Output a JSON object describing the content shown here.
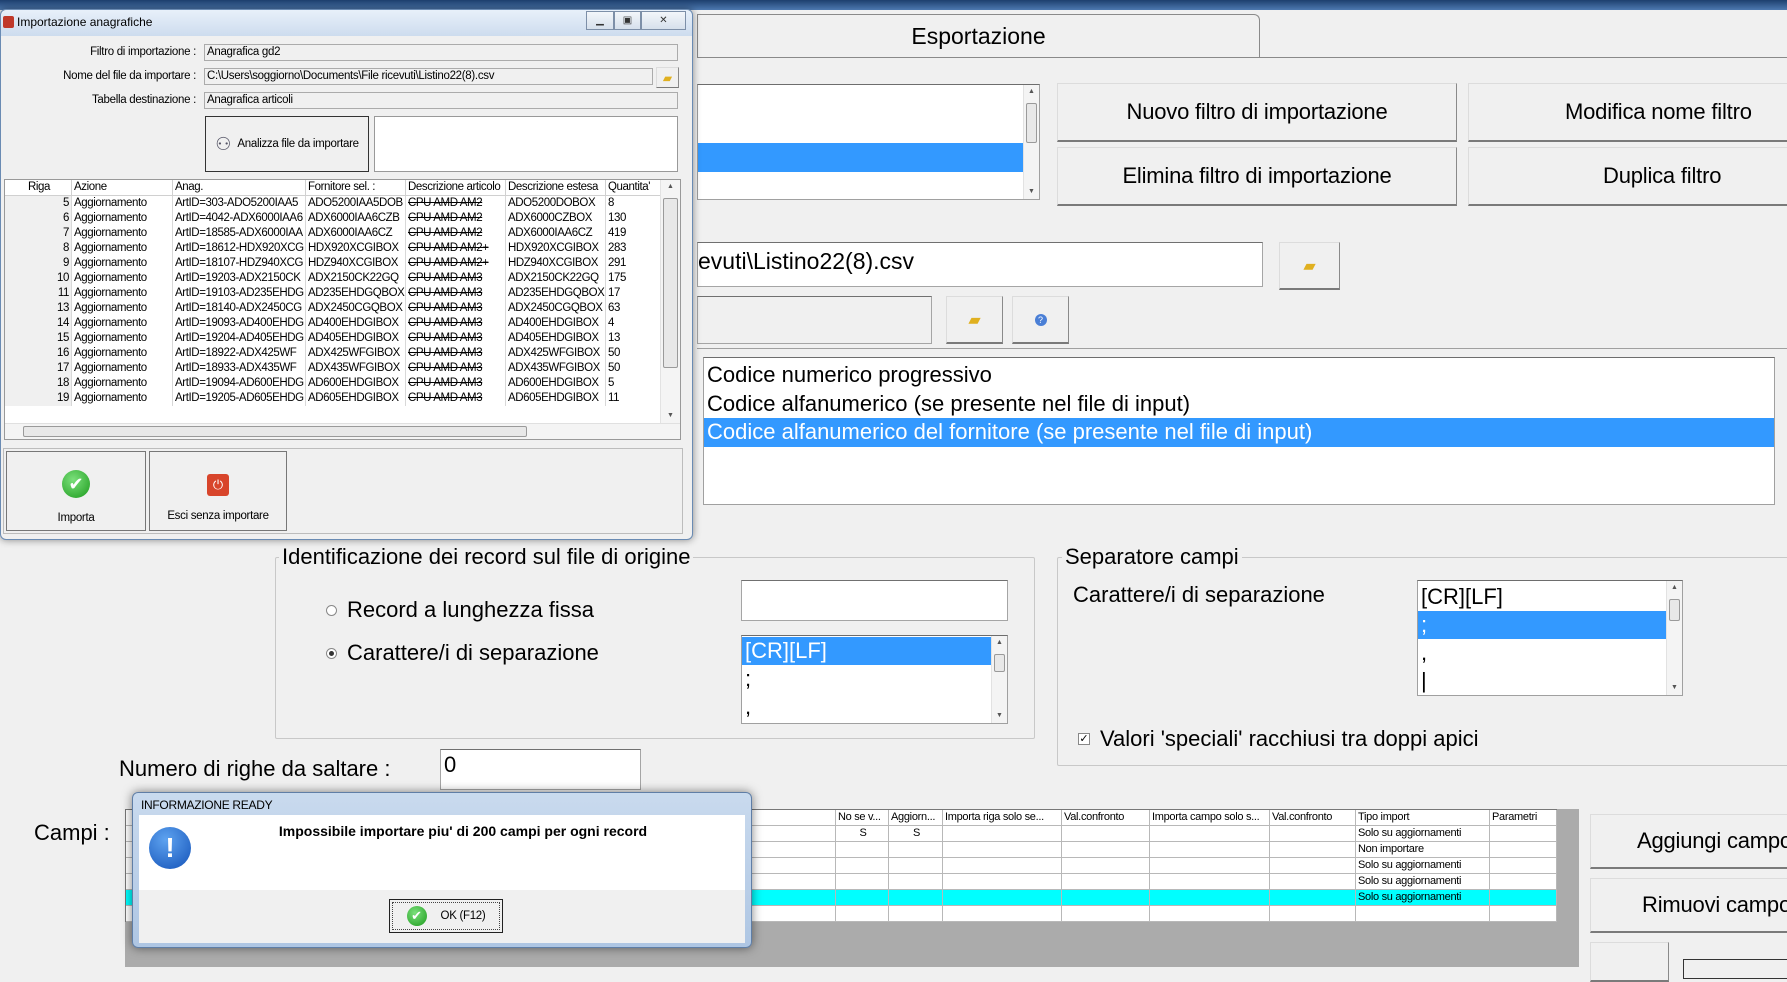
{
  "main": {
    "tab_label": "Esportazione",
    "filter_list": {
      "items": [
        "",
        "",
        ""
      ],
      "selected_index": 1
    },
    "buttons": {
      "new_filter": "Nuovo filtro di importazione",
      "rename_filter": "Modifica nome filtro",
      "delete_filter": "Elimina filtro di importazione",
      "duplicate_filter": "Duplica filtro"
    },
    "file_path_value": "evuti\\Listino22(8).csv",
    "code_options": {
      "items": [
        "Codice numerico progressivo",
        "Codice alfanumerico (se presente nel file di input)",
        "Codice alfanumerico del fornitore (se presente nel file di input)"
      ],
      "selected_index": 2
    },
    "record_group": {
      "legend": "Identificazione dei record sul file di origine",
      "radio_fixed": "Record a lunghezza fissa",
      "radio_separator": "Carattere/i di separazione",
      "selected": "separator",
      "separator_options": [
        "[CR][LF]",
        ";",
        ","
      ],
      "separator_selected_index": 0
    },
    "field_group": {
      "legend": "Separatore campi",
      "label": "Carattere/i di separazione",
      "options": [
        "[CR][LF]",
        ";",
        ",",
        "|"
      ],
      "selected_index": 1,
      "quotes_checkbox": "Valori 'speciali' racchiusi tra doppi apici",
      "quotes_checked": true
    },
    "skip_rows_label": "Numero di righe da saltare  :",
    "skip_rows_value": "0",
    "fields_label": "Campi :",
    "fields_grid": {
      "columns": [
        "",
        "No se v...",
        "Aggiorn...",
        "Importa riga solo se...",
        "Val.confronto",
        "Importa campo solo s...",
        "Val.confronto",
        "Tipo import",
        "Parametri"
      ],
      "rows": [
        [
          "",
          "S",
          "S",
          "",
          "",
          "",
          "",
          "Solo su aggiornamenti",
          ""
        ],
        [
          "",
          "",
          "",
          "",
          "",
          "",
          "",
          "Non importare",
          ""
        ],
        [
          "",
          "",
          "",
          "",
          "",
          "",
          "",
          "Solo su aggiornamenti",
          ""
        ],
        [
          "",
          "",
          "",
          "",
          "",
          "",
          "",
          "Solo su aggiornamenti",
          ""
        ],
        [
          "",
          "",
          "",
          "",
          "",
          "",
          "",
          "Solo su aggiornamenti",
          ""
        ],
        [
          "",
          "",
          "",
          "",
          "",
          "",
          "",
          "",
          ""
        ]
      ],
      "highlight_row": 4,
      "highlight_color": "#00ffff"
    },
    "add_field": "Aggiungi campo",
    "remove_field": "Rimuovi campo"
  },
  "import_dialog": {
    "title": "Importazione anagrafiche",
    "filter_label": "Filtro di importazione :",
    "filter_value": "Anagrafica gd2",
    "file_label": "Nome del file da importare :",
    "file_value": "C:\\Users\\soggiorno\\Documents\\File ricevuti\\Listino22(8).csv",
    "table_label": "Tabella destinazione :",
    "table_value": "Anagrafica articoli",
    "analyze_button": "Analizza file da importare",
    "columns": [
      "Riga",
      "Azione",
      "Anag.",
      "Fornitore sel. :",
      "Descrizione articolo",
      "Descrizione estesa",
      "Quantita'"
    ],
    "rows": [
      [
        "5",
        "Aggiornamento",
        "ArtID=303-ADO5200IAA5",
        "ADO5200IAA5DOB",
        "CPU AMD AM2",
        "ADO5200DOBOX",
        "8"
      ],
      [
        "6",
        "Aggiornamento",
        "ArtID=4042-ADX6000IAA6",
        "ADX6000IAA6CZB",
        "CPU AMD AM2",
        "ADX6000CZBOX",
        "130"
      ],
      [
        "7",
        "Aggiornamento",
        "ArtID=18585-ADX6000IAA",
        "ADX6000IAA6CZ",
        "CPU AMD AM2",
        "ADX6000IAA6CZ",
        "419"
      ],
      [
        "8",
        "Aggiornamento",
        "ArtID=18612-HDX920XCG",
        "HDX920XCGIBOX",
        "CPU AMD AM2+",
        "HDX920XCGIBOX",
        "283"
      ],
      [
        "9",
        "Aggiornamento",
        "ArtID=18107-HDZ940XCG",
        "HDZ940XCGIBOX",
        "CPU AMD AM2+",
        "HDZ940XCGIBOX",
        "291"
      ],
      [
        "10",
        "Aggiornamento",
        "ArtID=19203-ADX2150CK",
        "ADX2150CK22GQ",
        "CPU AMD AM3",
        "ADX2150CK22GQ",
        "175"
      ],
      [
        "11",
        "Aggiornamento",
        "ArtID=19103-AD235EHDG",
        "AD235EHDGQBOX",
        "CPU AMD AM3",
        "AD235EHDGQBOX",
        "17"
      ],
      [
        "13",
        "Aggiornamento",
        "ArtID=18140-ADX2450CG",
        "ADX2450CGQBOX",
        "CPU AMD AM3",
        "ADX2450CGQBOX",
        "63"
      ],
      [
        "14",
        "Aggiornamento",
        "ArtID=19093-AD400EHDG",
        "AD400EHDGIBOX",
        "CPU AMD AM3",
        "AD400EHDGIBOX",
        "4"
      ],
      [
        "15",
        "Aggiornamento",
        "ArtID=19204-AD405EHDG",
        "AD405EHDGIBOX",
        "CPU AMD AM3",
        "AD405EHDGIBOX",
        "13"
      ],
      [
        "16",
        "Aggiornamento",
        "ArtID=18922-ADX425WF",
        "ADX425WFGIBOX",
        "CPU AMD AM3",
        "ADX425WFGIBOX",
        "50"
      ],
      [
        "17",
        "Aggiornamento",
        "ArtID=18933-ADX435WF",
        "ADX435WFGIBOX",
        "CPU AMD AM3",
        "ADX435WFGIBOX",
        "50"
      ],
      [
        "18",
        "Aggiornamento",
        "ArtID=19094-AD600EHDG",
        "AD600EHDGIBOX",
        "CPU AMD AM3",
        "AD600EHDGIBOX",
        "5"
      ],
      [
        "19",
        "Aggiornamento",
        "ArtID=19205-AD605EHDG",
        "AD605EHDGIBOX",
        "CPU AMD AM3",
        "AD605EHDGIBOX",
        "11"
      ]
    ],
    "import_button": "Importa",
    "exit_button": "Esci senza importare"
  },
  "info_dialog": {
    "title": "INFORMAZIONE READY",
    "message": "Impossibile importare piu' di 200 campi per ogni record",
    "ok_button": "OK (F12)"
  }
}
